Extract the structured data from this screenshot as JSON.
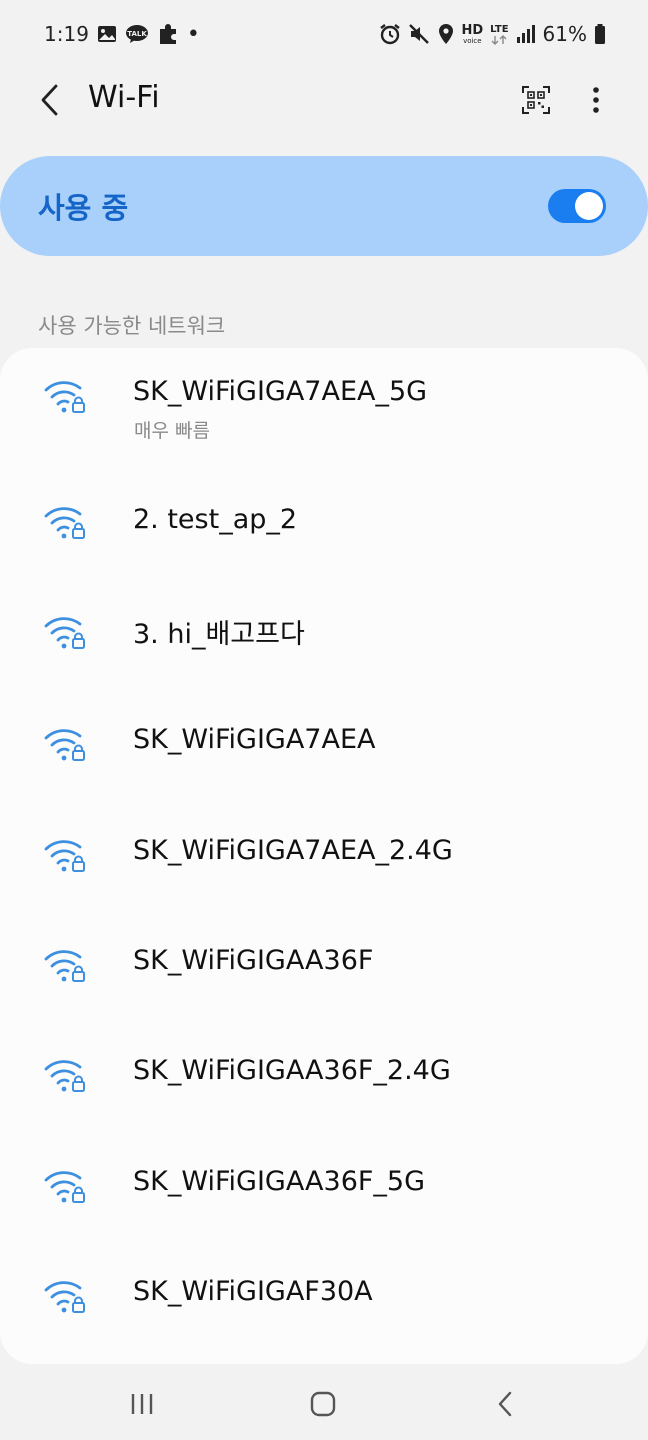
{
  "status": {
    "time": "1:19",
    "dot": "•",
    "hd": "HD",
    "voice": "voice",
    "lte": "LTE",
    "battery": "61%",
    "kakao": "TALK"
  },
  "app_bar": {
    "title": "Wi-Fi"
  },
  "master": {
    "label": "사용 중",
    "on": true
  },
  "section": {
    "available": "사용 가능한 네트워크"
  },
  "networks": [
    {
      "name": "SK_WiFiGIGA7AEA_5G",
      "sub": "매우 빠름"
    },
    {
      "name": "2. test_ap_2"
    },
    {
      "name": "3. hi_배고프다"
    },
    {
      "name": "SK_WiFiGIGA7AEA"
    },
    {
      "name": "SK_WiFiGIGA7AEA_2.4G"
    },
    {
      "name": "SK_WiFiGIGAA36F"
    },
    {
      "name": "SK_WiFiGIGAA36F_2.4G"
    },
    {
      "name": "SK_WiFiGIGAA36F_5G"
    },
    {
      "name": "SK_WiFiGIGAF30A"
    }
  ],
  "colors": {
    "accent": "#1a7ef0",
    "master_bg": "#a8d0fb",
    "master_label": "#1565c8",
    "wifi_icon": "#3d8fe0"
  },
  "icons": {
    "back": "chevron-left-icon",
    "qr": "qr-code-icon",
    "more": "more-vertical-icon",
    "wifi": "wifi-lock-icon",
    "nav_recent": "recent-apps-icon",
    "nav_home": "home-icon",
    "nav_back": "nav-back-icon"
  }
}
